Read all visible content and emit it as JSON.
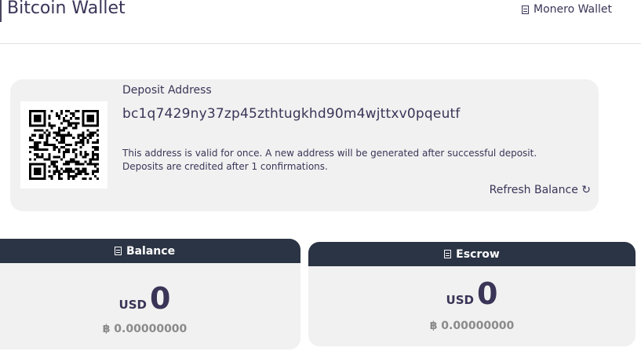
{
  "header": {
    "title": "Bitcoin Wallet",
    "monero_link": "Monero Wallet",
    "monero_icon": "wallet-icon"
  },
  "deposit": {
    "label": "Deposit Address",
    "address": "bc1q7429ny37zp45zthtugkhd90m4wjttxv0pqeutf",
    "note_line1": "This address is valid for once. A new address will be generated after successful deposit.",
    "note_line2": "Deposits are credited after 1 confirmations.",
    "refresh_label": "Refresh Balance ↻"
  },
  "balance": {
    "title": "Balance",
    "currency": "USD",
    "amount": "0",
    "btc": "฿ 0.00000000",
    "icon": "wallet-icon"
  },
  "escrow": {
    "title": "Escrow",
    "currency": "USD",
    "amount": "0",
    "btc": "฿ 0.00000000",
    "icon": "wallet-icon"
  },
  "colors": {
    "text": "#3a3557",
    "card": "#f1f1f1",
    "header_dark": "#2b3444",
    "muted": "#8a8a8a"
  }
}
